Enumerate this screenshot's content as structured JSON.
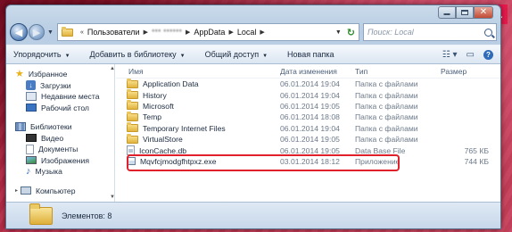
{
  "badge": "1",
  "address": {
    "crumbs": [
      "Пользователи",
      "*** ******",
      "AppData",
      "Local"
    ],
    "search_placeholder": "Поиск: Local"
  },
  "toolbar": {
    "organize": "Упорядочить",
    "add_to_library": "Добавить в библиотеку",
    "share": "Общий доступ",
    "new_folder": "Новая папка"
  },
  "nav": {
    "favorites": "Избранное",
    "downloads": "Загрузки",
    "recent": "Недавние места",
    "desktop": "Рабочий стол",
    "libraries": "Библиотеки",
    "video": "Видео",
    "documents": "Документы",
    "images": "Изображения",
    "music": "Музыка",
    "computer": "Компьютер"
  },
  "columns": {
    "name": "Имя",
    "date": "Дата изменения",
    "type": "Тип",
    "size": "Размер"
  },
  "files": [
    {
      "name": "Application Data",
      "date": "06.01.2014 19:04",
      "type": "Папка с файлами",
      "size": "",
      "icon": "folder-icon"
    },
    {
      "name": "History",
      "date": "06.01.2014 19:04",
      "type": "Папка с файлами",
      "size": "",
      "icon": "folder-icon"
    },
    {
      "name": "Microsoft",
      "date": "06.01.2014 19:05",
      "type": "Папка с файлами",
      "size": "",
      "icon": "folder-icon"
    },
    {
      "name": "Temp",
      "date": "06.01.2014 18:08",
      "type": "Папка с файлами",
      "size": "",
      "icon": "folder-icon"
    },
    {
      "name": "Temporary Internet Files",
      "date": "06.01.2014 19:04",
      "type": "Папка с файлами",
      "size": "",
      "icon": "folder-icon"
    },
    {
      "name": "VirtualStore",
      "date": "06.01.2014 19:05",
      "type": "Папка с файлами",
      "size": "",
      "icon": "folder-icon"
    },
    {
      "name": "IconCache.db",
      "date": "06.01.2014 19:05",
      "type": "Data Base File",
      "size": "765 КБ",
      "icon": "database-file-icon"
    },
    {
      "name": "Mqvfcjmodgfhtpxz.exe",
      "date": "03.01.2014 18:12",
      "type": "Приложение",
      "size": "744 КБ",
      "icon": "executable-icon"
    }
  ],
  "status": {
    "items_count": "Элементов: 8"
  },
  "colors": {
    "highlight_border": "#e0202a",
    "badge": "#e5194b"
  }
}
